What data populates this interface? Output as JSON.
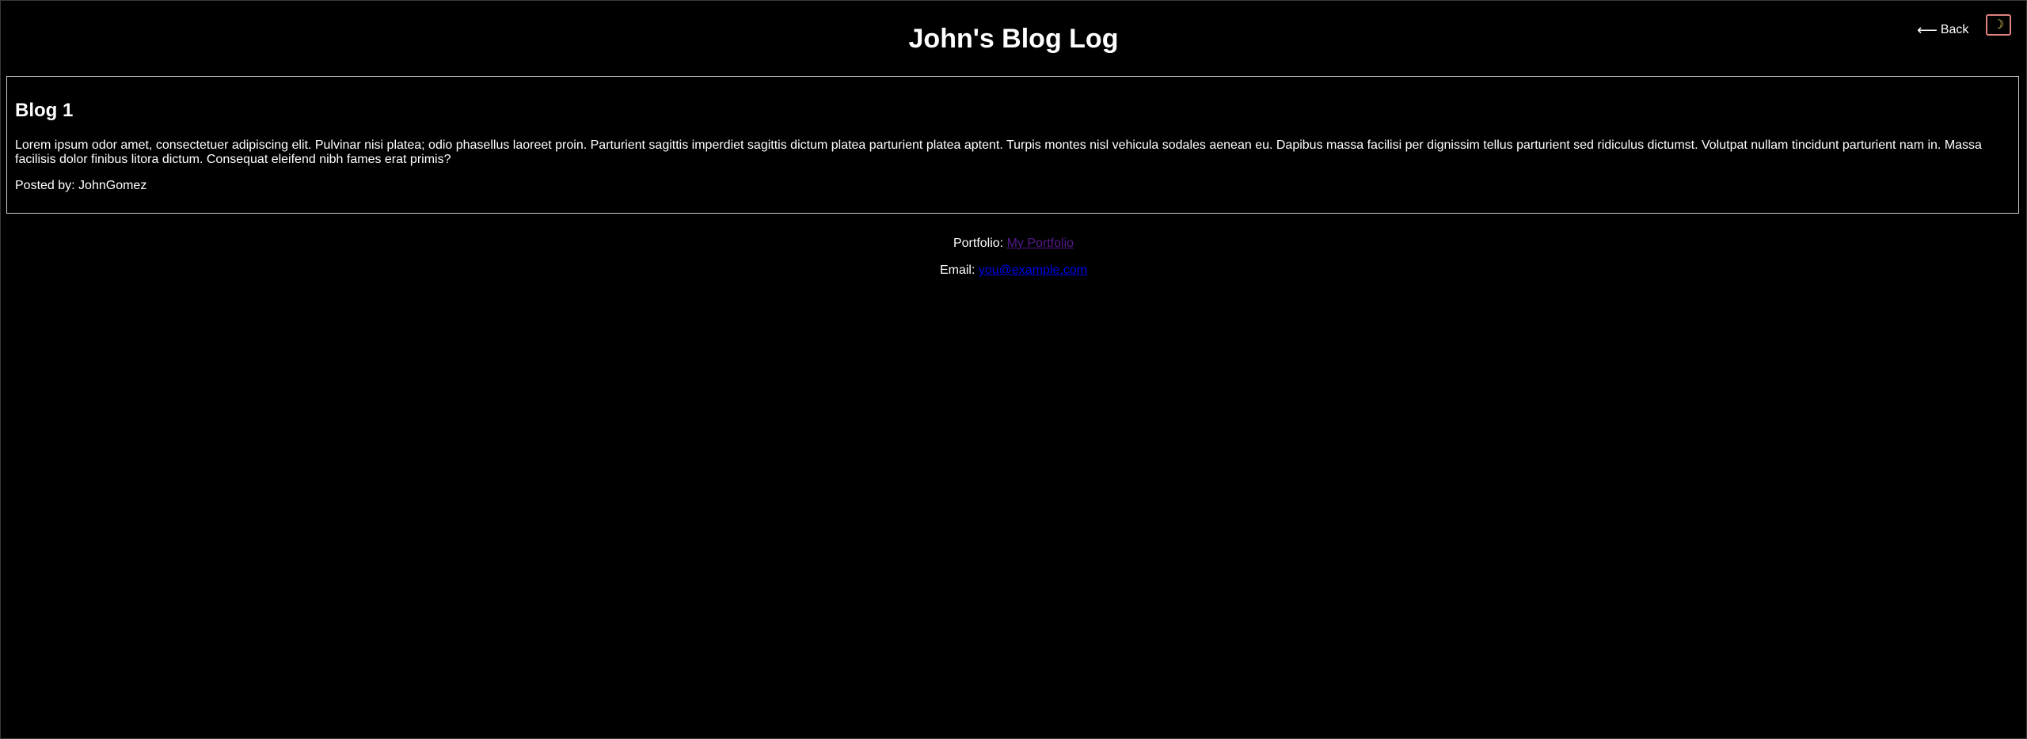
{
  "header": {
    "title": "John's Blog Log",
    "back_arrow": "⟵",
    "back_label": "Back",
    "theme_toggle_icon": "moon-icon",
    "theme_toggle_glyph": "☽"
  },
  "posts": [
    {
      "title": "Blog 1",
      "body": "Lorem ipsum odor amet, consectetuer adipiscing elit. Pulvinar nisi platea; odio phasellus laoreet proin. Parturient sagittis imperdiet sagittis dictum platea parturient platea aptent. Turpis montes nisl vehicula sodales aenean eu. Dapibus massa facilisi per dignissim tellus parturient sed ridiculus dictumst. Volutpat nullam tincidunt parturient nam in. Massa facilisis dolor finibus litora dictum. Consequat eleifend nibh fames erat primis?",
      "author_label": "Posted by: JohnGomez"
    }
  ],
  "footer": {
    "portfolio_label": "Portfolio:",
    "portfolio_link_text": "My Portfolio",
    "email_label": "Email:",
    "email_link_text": "you@example.com"
  },
  "colors": {
    "background": "#000000",
    "text": "#ffffff",
    "visited_link": "#551a8b",
    "link": "#0000ee",
    "toggle_border": "#e0827e",
    "moon": "#f4d35e"
  }
}
